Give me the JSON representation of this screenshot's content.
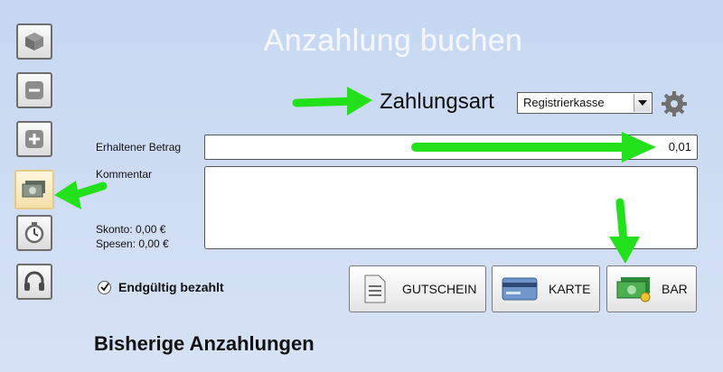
{
  "title": "Anzahlung buchen",
  "payment": {
    "label": "Zahlungsart",
    "selected": "Registrierkasse"
  },
  "form": {
    "received_label": "Erhaltener Betrag",
    "received_value": "0,01",
    "comment_label": "Kommentar",
    "skonto": "Skonto: 0,00 €",
    "spesen": "Spesen: 0,00 €",
    "final_paid_label": "Endgültig bezahlt",
    "final_paid_checked": true
  },
  "buttons": {
    "voucher": "GUTSCHEIN",
    "card": "KARTE",
    "cash": "BAR"
  },
  "section": {
    "previous_deposits": "Bisherige Anzahlungen"
  },
  "sidebar": {
    "items": [
      {
        "icon": "package-icon",
        "active": false
      },
      {
        "icon": "minus-icon",
        "active": false
      },
      {
        "icon": "plus-icon",
        "active": false
      },
      {
        "icon": "cash-icon",
        "active": true
      },
      {
        "icon": "timer-icon",
        "active": false
      },
      {
        "icon": "headset-icon",
        "active": false
      }
    ]
  },
  "colors": {
    "background": "#cddcf3",
    "annotation_arrow": "#22e01a",
    "active_sidebar": "#f3dfa9"
  }
}
